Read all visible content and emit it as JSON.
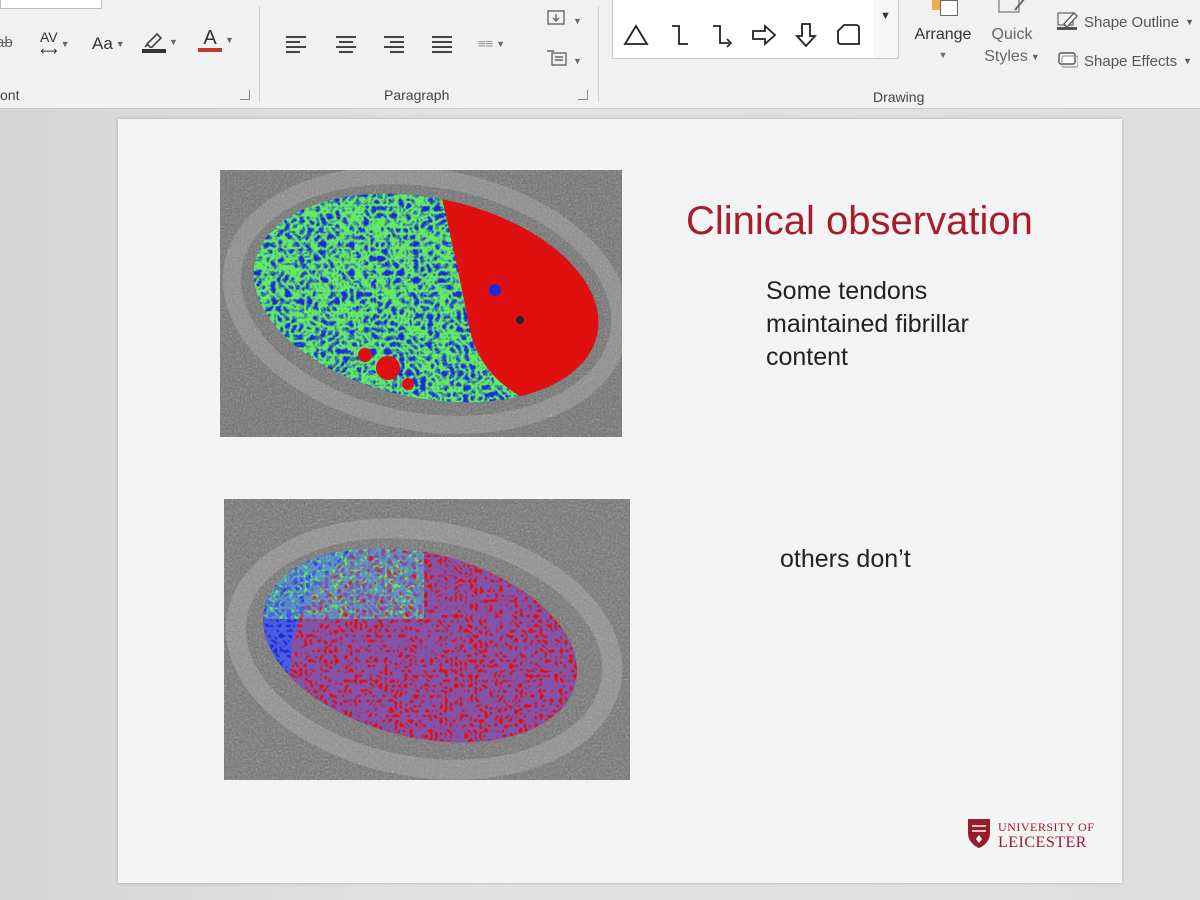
{
  "ribbon": {
    "font_group": {
      "label_partial": "ont",
      "spacing_label": "AV",
      "case_label": "Aa",
      "font_color_label": "A"
    },
    "paragraph_group": {
      "label": "Paragraph"
    },
    "drawing_group": {
      "label": "Drawing",
      "arrange_label": "Arrange",
      "quick_styles_label_1": "Quick",
      "quick_styles_label_2": "Styles",
      "shape_outline_label": "Shape Outline",
      "shape_effects_label": "Shape Effects",
      "shapes": [
        "triangle-icon",
        "elbow-connector-icon",
        "elbow-arrow-connector-icon",
        "right-arrow-icon",
        "down-arrow-icon",
        "snip-rectangle-icon"
      ]
    }
  },
  "slide": {
    "title": "Clinical observation",
    "text_1_line_1": "Some tendons",
    "text_1_line_2": "maintained fibrillar",
    "text_1_line_3": "content",
    "text_2": "others don’t",
    "logo_line_1": "UNIVERSITY OF",
    "logo_line_2": "LEICESTER",
    "images": [
      {
        "description": "ultrasound-tendon-cross-section-mixed"
      },
      {
        "description": "ultrasound-tendon-cross-section-mostly-red"
      }
    ]
  },
  "colors": {
    "title": "#a61d2d",
    "overlay_red": "#e01010",
    "overlay_green": "#22d022",
    "overlay_blue": "#1a2bd8"
  }
}
